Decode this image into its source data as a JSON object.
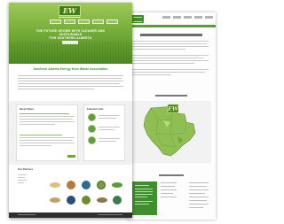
{
  "hero": {
    "logo_text": "EW",
    "headline": "THE FUTURE GROWS WITH CLEANER AND SUSTAINABLE",
    "headline_line2": "FOR SOUTHERN ALBERTA",
    "nav_items": [
      "",
      "",
      "",
      "",
      ""
    ]
  },
  "intro": {
    "title": "Southern Alberta Energy from Waste Association"
  },
  "cards": {
    "news_title": "Recent News",
    "programs_title": "Featured Links",
    "news_headline_1": "",
    "news_headline_2": ""
  },
  "partners": {
    "title": "Our Partners"
  },
  "colors": {
    "brand_green": "#4b8f2a",
    "hero_light": "#9fc95a",
    "hero_dark": "#4f8a22",
    "footer": "#2f2f2f"
  },
  "icons": [
    "logo-icon",
    "map-icon",
    "partner-logo-icon",
    "program-circle-icon"
  ]
}
